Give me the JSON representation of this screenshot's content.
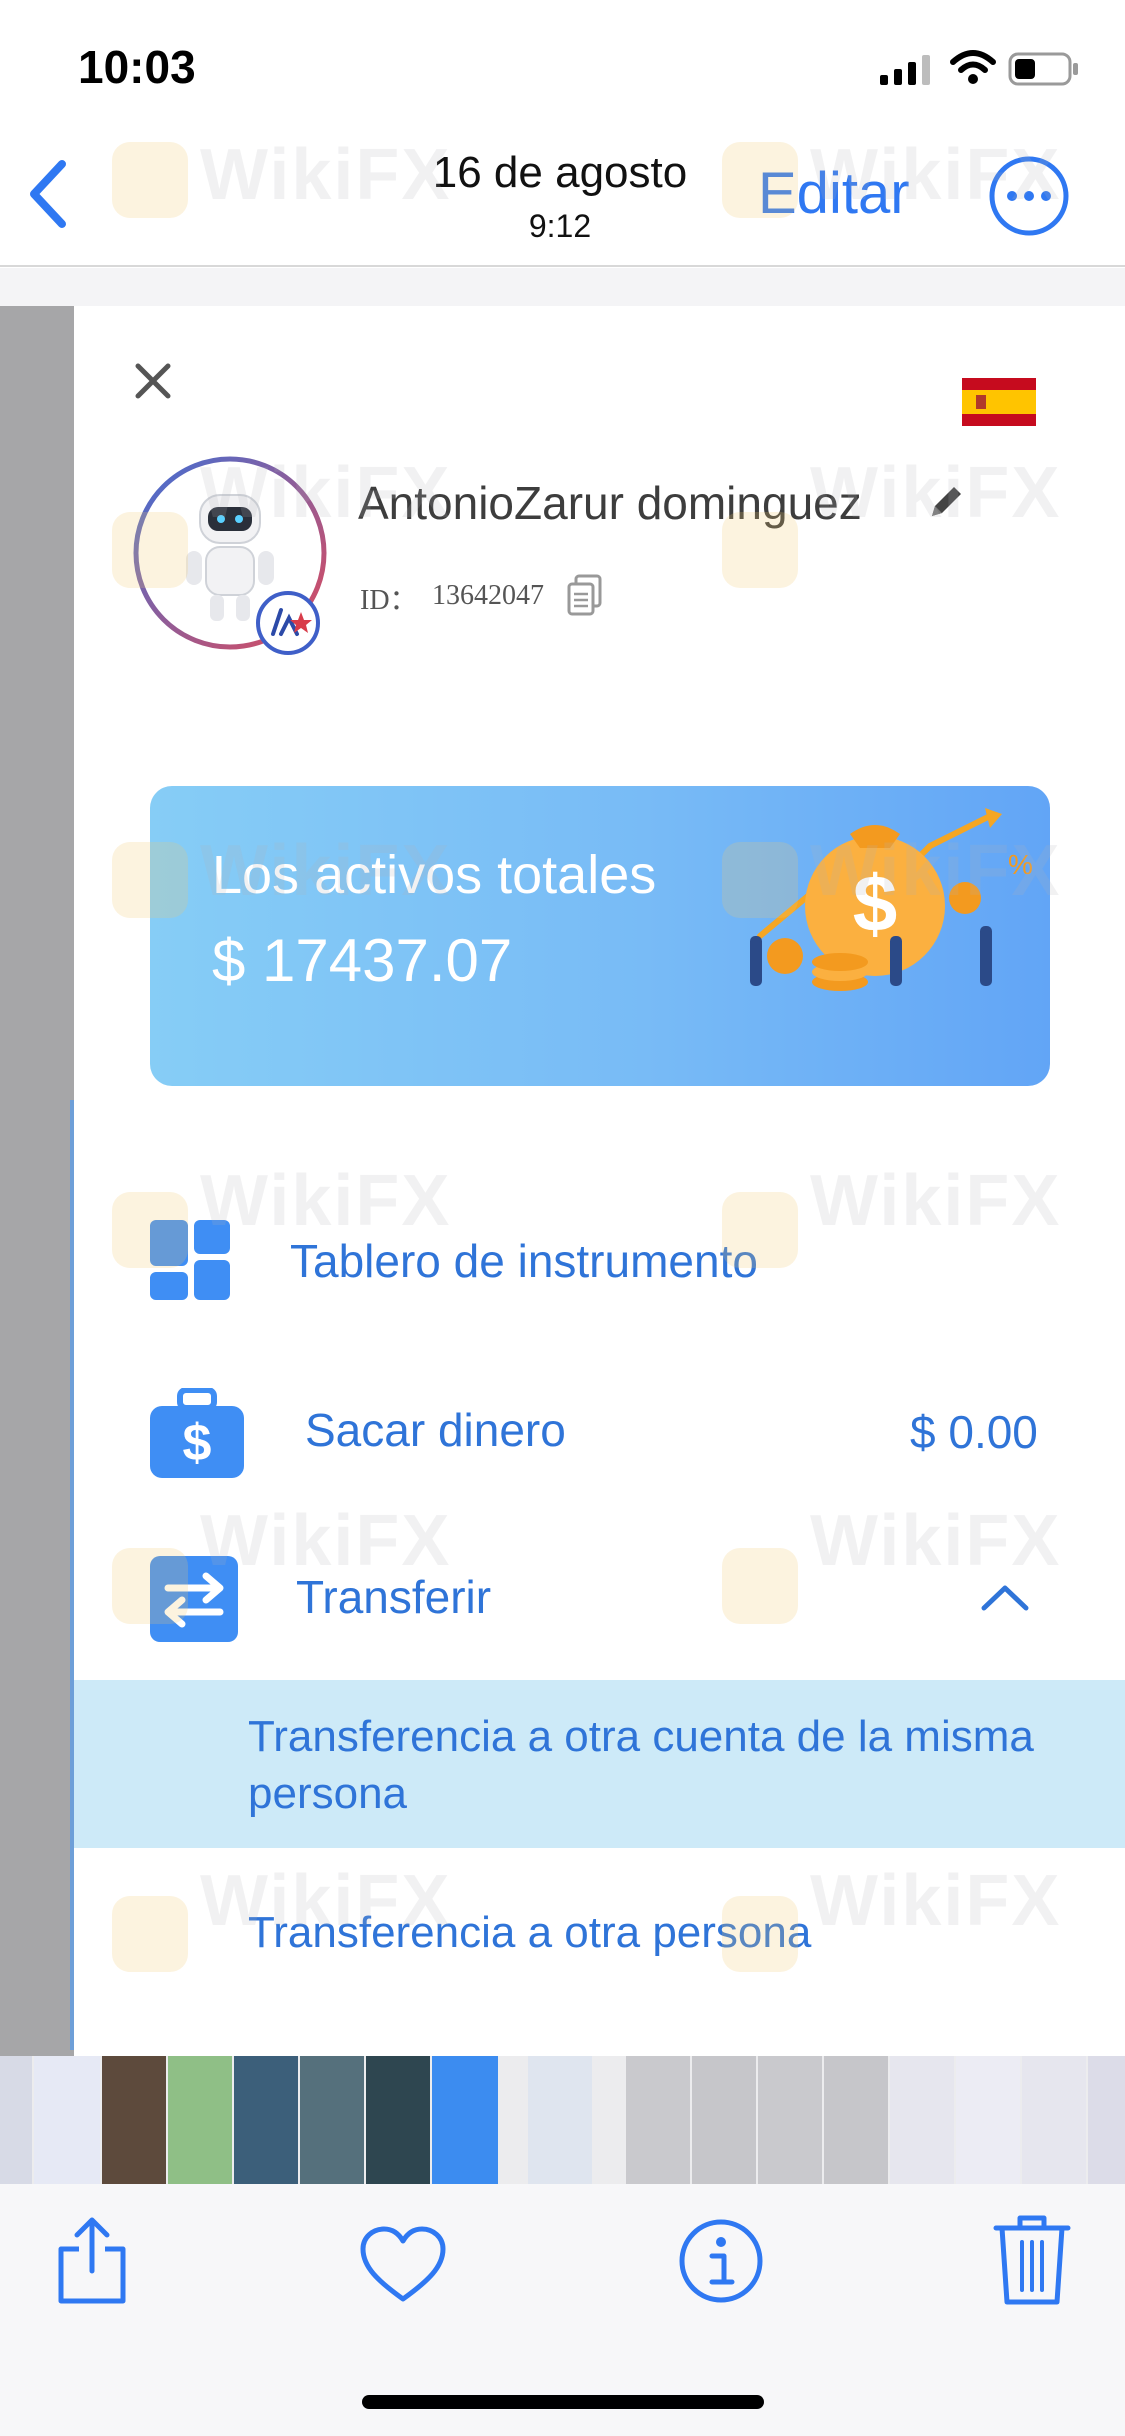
{
  "status_bar": {
    "time": "10:03"
  },
  "nav": {
    "date": "16 de agosto",
    "time": "9:12",
    "edit_label": "Editar"
  },
  "profile": {
    "name": "AntonioZarur dominguez",
    "id_label": "ID：",
    "id_value": "13642047"
  },
  "assets": {
    "title": "Los activos totales",
    "amount": "$ 17437.07"
  },
  "menu": {
    "items": [
      {
        "label": "Tablero de instrumento"
      },
      {
        "label": "Sacar dinero",
        "amount": "$ 0.00"
      },
      {
        "label": "Transferir"
      }
    ],
    "submenu": [
      {
        "label": "Transferencia a otra cuenta de la misma persona"
      },
      {
        "label": "Transferencia a otra persona"
      }
    ]
  },
  "watermark": {
    "text": "WikiFX"
  },
  "colors": {
    "accent": "#2F74D8",
    "ios_blue": "#2F78F2",
    "highlight": "#CDEAF8",
    "card_start": "#86CDF6",
    "card_end": "#62A5F6"
  },
  "icons": [
    "back-chevron-icon",
    "more-icon",
    "close-icon",
    "spain-flag-icon",
    "edit-pencil-icon",
    "copy-icon",
    "dashboard-icon",
    "wallet-dollar-icon",
    "transfer-arrows-icon",
    "chevron-up-icon",
    "share-icon",
    "heart-icon",
    "info-icon",
    "trash-icon"
  ]
}
